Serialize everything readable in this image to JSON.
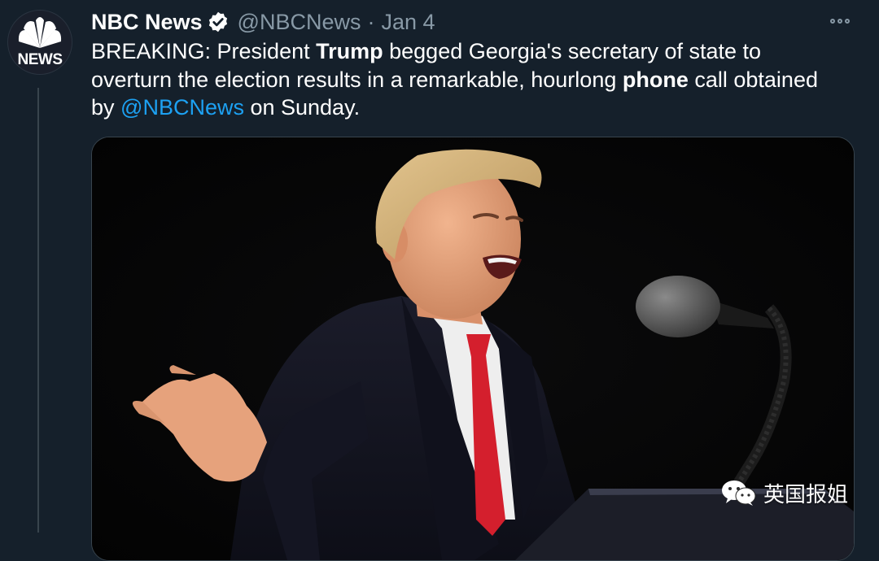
{
  "account": {
    "display_name": "NBC News",
    "handle": "@NBCNews",
    "separator": "·",
    "date": "Jan 4",
    "verified": true,
    "avatar_text": "NEWS"
  },
  "tweet": {
    "segments": [
      {
        "text": "BREAKING: President ",
        "style": "normal"
      },
      {
        "text": "Trump",
        "style": "bold"
      },
      {
        "text": " begged Georgia's secretary of state to overturn the election results in a remarkable, hourlong ",
        "style": "normal"
      },
      {
        "text": "phone",
        "style": "bold"
      },
      {
        "text": " call obtained by ",
        "style": "normal"
      },
      {
        "text": "@NBCNews",
        "style": "mention"
      },
      {
        "text": " on Sunday.",
        "style": "normal"
      }
    ]
  },
  "watermark": {
    "text": "英国报姐",
    "icon": "wechat-icon"
  },
  "icons": {
    "verified": "verified-badge-icon",
    "more": "more-options-icon"
  },
  "colors": {
    "background": "#15202b",
    "text_secondary": "#8899a6",
    "link": "#1da1f2",
    "border": "#38444d"
  }
}
